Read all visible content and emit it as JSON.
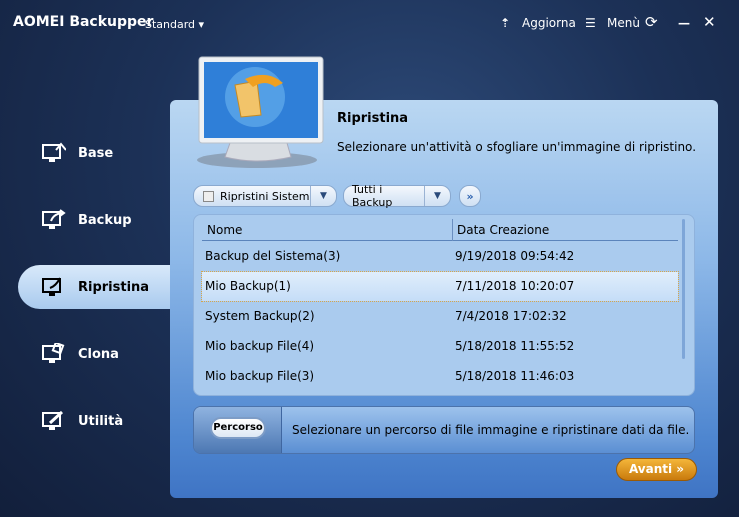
{
  "app": {
    "title": "AOMEI Backupper",
    "edition": "Standard ▾",
    "update": "Aggiorna",
    "menu": "Menù",
    "minimize": "—",
    "close": "✕"
  },
  "sidebar": {
    "items": [
      {
        "label": "Base"
      },
      {
        "label": "Backup"
      },
      {
        "label": "Ripristina",
        "active": true
      },
      {
        "label": "Clona"
      },
      {
        "label": "Utilità"
      }
    ]
  },
  "main": {
    "title": "Ripristina",
    "subtitle": "Selezionare un'attività o sfogliare un'immagine di ripristino.",
    "filter1": "Ripristini Sistema",
    "filter2": "Tutti i Backup",
    "more": "»",
    "table": {
      "columns": [
        "Nome",
        "Data Creazione"
      ],
      "rows": [
        [
          "Backup del Sistema(3)",
          "9/19/2018 09:54:42"
        ],
        [
          "Mio Backup(1)",
          "7/11/2018 10:20:07"
        ],
        [
          "System Backup(2)",
          "7/4/2018 17:02:32"
        ],
        [
          "Mio backup File(4)",
          "5/18/2018 11:55:52"
        ],
        [
          "Mio backup File(3)",
          "5/18/2018 11:46:03"
        ]
      ],
      "selected_index": 1
    },
    "path": {
      "button": "Percorso",
      "text": "Selezionare un percorso di file immagine e ripristinare dati da file."
    },
    "next": "Avanti »"
  },
  "colors": {
    "accent": "#e8a020",
    "panel": "#9dc2ec",
    "background": "#1c3157"
  }
}
